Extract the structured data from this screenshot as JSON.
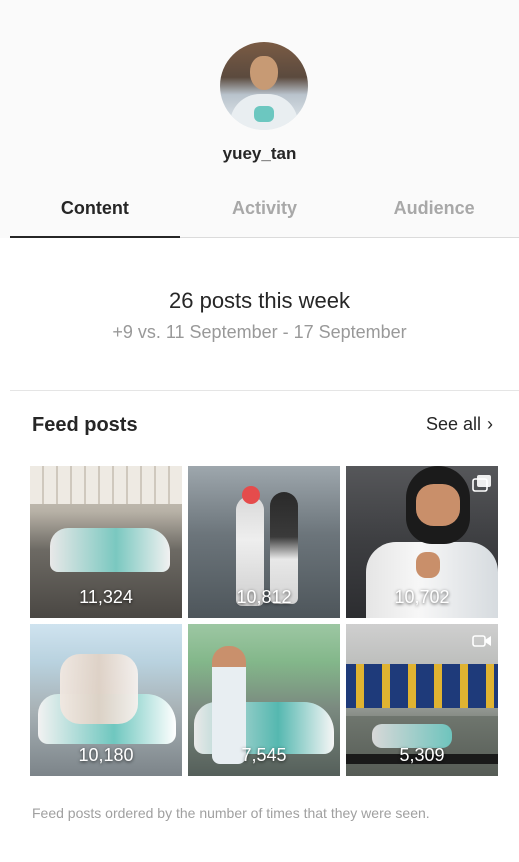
{
  "profile": {
    "username": "yuey_tan"
  },
  "tabs": [
    {
      "label": "Content",
      "active": true
    },
    {
      "label": "Activity",
      "active": false
    },
    {
      "label": "Audience",
      "active": false
    }
  ],
  "summary": {
    "posts_this_week": "26 posts this week",
    "comparison": "+9 vs. 11 September - 17 September"
  },
  "feed": {
    "title": "Feed posts",
    "see_all_label": "See all",
    "see_all_icon": "chevron-right-icon",
    "posts": [
      {
        "count": "11,324"
      },
      {
        "count": "10,812"
      },
      {
        "count": "10,702",
        "icon": "multiple-photos-icon"
      },
      {
        "count": "10,180"
      },
      {
        "count": "7,545"
      },
      {
        "count": "5,309",
        "icon": "video-camera-icon"
      }
    ],
    "footnote": "Feed posts ordered by the number of times that they were seen."
  },
  "colors": {
    "text_primary": "#262626",
    "text_muted": "#999999",
    "header_bg": "#fafafa",
    "divider": "#dbdbdb"
  }
}
